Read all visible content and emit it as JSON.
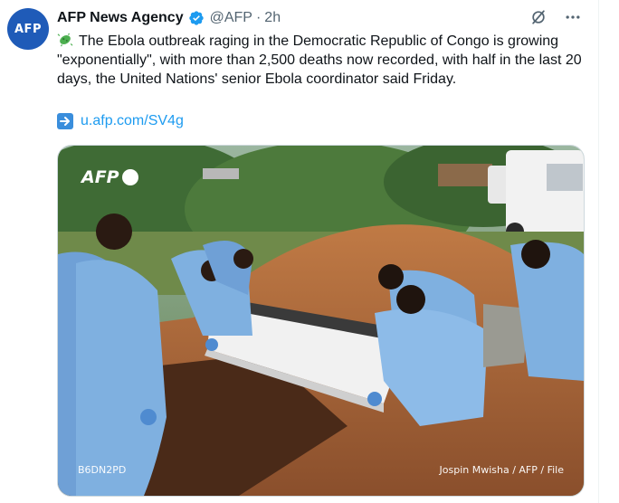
{
  "author": {
    "avatar_text": "AFP",
    "name": "AFP News Agency",
    "handle": "@AFP",
    "separator": "·",
    "time": "2h",
    "verified": true
  },
  "tweet": {
    "emoji_icon": "microbe-icon",
    "text": "The Ebola outbreak raging in the Democratic Republic of Congo is growing \"exponentially\", with more than 2,500 deaths now recorded, with half in the last 20 days, the United Nations' senior Ebola coordinator said Friday.",
    "link_icon": "right-arrow-icon",
    "link": "u.afp.com/SV4g"
  },
  "media": {
    "watermark": "AFP",
    "image_id": "B6DN2PD",
    "credit": "Jospin Mwisha / AFP / File"
  },
  "actions": {
    "grok_icon": "grok-icon",
    "more_icon": "more-icon"
  },
  "colors": {
    "accent": "#1d9bf0",
    "avatar_bg": "#1f5bb8",
    "secondary_text": "#536471"
  }
}
